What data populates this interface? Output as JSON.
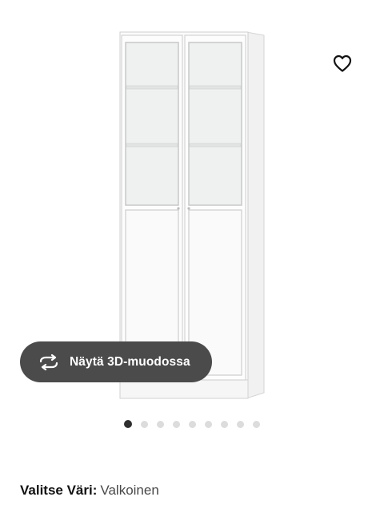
{
  "product": {
    "view_3d_label": "Näytä 3D-muodossa",
    "color_label": "Valitse Väri:",
    "color_value": "Valkoinen"
  },
  "icons": {
    "wishlist": "heart-icon",
    "view_3d": "rotate-arrows-icon"
  },
  "carousel": {
    "total": 9,
    "active_index": 0
  },
  "colors": {
    "button_bg": "#4b4b4b",
    "dot_active": "#2f2f2f",
    "dot_inactive": "#dcdcdc"
  }
}
